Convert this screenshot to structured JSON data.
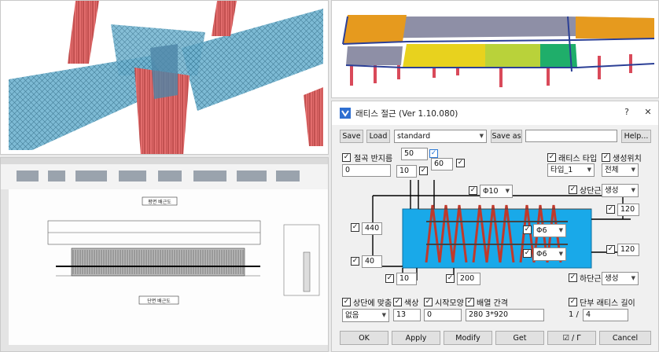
{
  "dialog": {
    "title": "래티스 절근 (Ver 1.10.080)",
    "toolbar": {
      "save": "Save",
      "load": "Load",
      "preset": "standard",
      "save_as": "Save as",
      "save_as_name": "",
      "help": "Help..."
    },
    "joint_half_length": {
      "label": "절곡 반지름",
      "value": "0"
    },
    "dims": {
      "top_50": "50",
      "top_60": "60",
      "top_10": "10",
      "left_440": "440",
      "left_40": "40",
      "bottom_10": "10",
      "bottom_200": "200",
      "right_120_top": "120",
      "right_120_bottom": "120"
    },
    "bar_dia": {
      "main": "Φ10",
      "upper": "Φ6",
      "lower": "Φ6"
    },
    "lattice_type": {
      "label": "래티스 타입",
      "value": "타입_1"
    },
    "create_position": {
      "label": "생성위치",
      "value": "전체"
    },
    "upper_bar": {
      "label": "상단근",
      "value": "생성"
    },
    "lower_bar": {
      "label": "하단근",
      "value": "생성"
    },
    "bottom_row": {
      "fit_to_top": {
        "label": "상단에 맞춤",
        "value": "없음"
      },
      "color": {
        "label": "색상",
        "value": "13"
      },
      "start_shape": {
        "label": "시작모양",
        "value": "0"
      },
      "spacing": {
        "label": "배열 간격",
        "value": "280 3*920"
      },
      "end_length": {
        "label": "단부 래티스 길이",
        "prefix": "1 /",
        "value": "4"
      }
    },
    "footer": {
      "ok": "OK",
      "apply": "Apply",
      "modify": "Modify",
      "get": "Get",
      "pick": "☑ / Γ",
      "cancel": "Cancel"
    }
  },
  "cad": {
    "title_top": "평면 배근도",
    "title_bottom": "단면 배근도"
  },
  "colors": {
    "slab_blue": "#19a9e9",
    "rebar_red": "#c0392b",
    "orange_slab": "#e69a1e",
    "yellow_slab": "#e8d21e",
    "green_slab": "#1fae6a",
    "column_red": "#d94a5a"
  }
}
